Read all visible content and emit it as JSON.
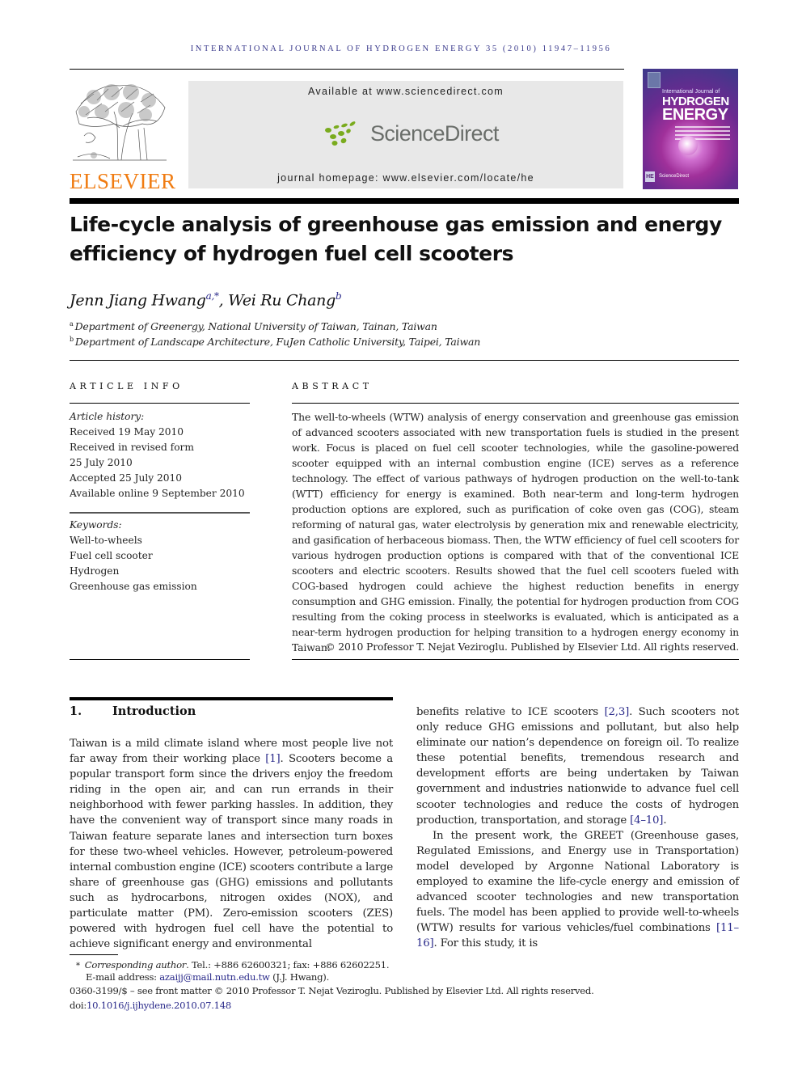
{
  "running_header": "INTERNATIONAL JOURNAL OF HYDROGEN ENERGY 35 (2010) 11947–11956",
  "header": {
    "publisher_name": "ELSEVIER",
    "available_at": "Available at www.sciencedirect.com",
    "sciencedirect_name": "ScienceDirect",
    "homepage": "journal homepage: www.elsevier.com/locate/he",
    "cover": {
      "line1": "International Journal of",
      "line2": "HYDROGEN",
      "line3": "ENERGY",
      "badge": "HE",
      "footer": "ScienceDirect"
    },
    "colors": {
      "elsevier_orange": "#f07c12",
      "sciencedirect_green": "#7aab1e",
      "sciencedirect_gray": "#6a6e6a",
      "banner_gray": "#e8e8e8",
      "link_blue": "#2a2a8a"
    }
  },
  "article": {
    "title": "Life-cycle analysis of greenhouse gas emission and energy efficiency of hydrogen fuel cell scooters",
    "authors": [
      {
        "name": "Jenn Jiang Hwang",
        "marks": "a,*"
      },
      {
        "name": "Wei Ru Chang",
        "marks": "b"
      }
    ],
    "author_separator": ", ",
    "affiliations": [
      {
        "mark": "a",
        "text": "Department of Greenergy, National University of Taiwan, Tainan, Taiwan"
      },
      {
        "mark": "b",
        "text": "Department of Landscape Architecture, FuJen Catholic University, Taipei, Taiwan"
      }
    ]
  },
  "article_info": {
    "label": "ARTICLE INFO",
    "history_label": "Article history:",
    "history": [
      "Received 19 May 2010",
      "Received in revised form",
      "25 July 2010",
      "Accepted 25 July 2010",
      "Available online 9 September 2010"
    ],
    "keywords_label": "Keywords:",
    "keywords": [
      "Well-to-wheels",
      "Fuel cell scooter",
      "Hydrogen",
      "Greenhouse gas emission"
    ]
  },
  "abstract": {
    "label": "ABSTRACT",
    "text": "The well-to-wheels (WTW) analysis of energy conservation and greenhouse gas emission of advanced scooters associated with new transportation fuels is studied in the present work. Focus is placed on fuel cell scooter technologies, while the gasoline-powered scooter equipped with an internal combustion engine (ICE) serves as a reference technology. The effect of various pathways of hydrogen production on the well-to-tank (WTT) efficiency for energy is examined. Both near-term and long-term hydrogen production options are explored, such as purification of coke oven gas (COG), steam reforming of natural gas, water electrolysis by generation mix and renewable electricity, and gasification of herba­ceous biomass. Then, the WTW efficiency of fuel cell scooters for various hydrogen production options is compared with that of the conventional ICE scooters and electric scooters. Results showed that the fuel cell scooters fueled with COG-based hydrogen could achieve the highest reduction benefits in energy consumption and GHG emission. Finally, the potential for hydrogen production from COG resulting from the coking process in steelworks is evaluated, which is anticipated as a near-term hydrogen production for helping transition to a hydrogen energy economy in Taiwan.",
    "copyright": "© 2010 Professor T. Nejat Veziroglu. Published by Elsevier Ltd. All rights reserved."
  },
  "introduction": {
    "number": "1.",
    "heading": "Introduction",
    "left_column": [
      {
        "t": "Taiwan is a mild climate island where most people live not far away from their working place "
      },
      {
        "ref": "[1]"
      },
      {
        "t": ". Scooters become a popular transport form since the drivers enjoy the freedom riding in the open air, and can run errands in their neighborhood with fewer parking hassles. In addition, they have the convenient way of transport since many roads in Taiwan feature separate lanes and intersection turn boxes for these two-wheel vehi­cles. However, petroleum-powered internal combustion engine (ICE) scooters contribute a large share of greenhouse gas (GHG) emissions and pollutants such as hydrocarbons, nitrogen oxides (NOX), and particulate matter (PM). Zero-emission scooters (ZES) powered with hydrogen fuel cell have the potential to achieve significant energy and environmental"
      }
    ],
    "right_column_p1": [
      {
        "t": "benefits relative to ICE scooters "
      },
      {
        "ref": "[2,3]"
      },
      {
        "t": ". Such scooters not only reduce GHG emissions and pollutant, but also help eliminate our nation’s dependence on foreign oil. To realize these potential benefits, tremendous research and development efforts are being undertaken by Taiwan government and industries nationwide to advance fuel cell scooter technolo­gies and reduce the costs of hydrogen production, trans­portation, and storage "
      },
      {
        "ref": "[4–10]"
      },
      {
        "t": "."
      }
    ],
    "right_column_p2": [
      {
        "t": "In the present work, the GREET (Greenhouse gases, Regu­lated Emissions, and Energy use in Transportation) model developed by Argonne National Laboratory is employed to examine the life-cycle energy and emission of advanced scooter technologies and new transportation fuels. The model has been applied to provide well-to-wheels (WTW) results for various vehicles/fuel combinations "
      },
      {
        "ref": "[11–16]"
      },
      {
        "t": ". For this study, it is"
      }
    ]
  },
  "footnotes": {
    "star": "*",
    "corresponding_label": "Corresponding author",
    "contact": ". Tel.: +886 62600321; fax: +886 62602251.",
    "email_label": "E-mail address: ",
    "email": "azaijj@mail.nutn.edu.tw",
    "email_suffix": " (J.J. Hwang).",
    "front_matter": "0360-3199/$ – see front matter © 2010 Professor T. Nejat Veziroglu. Published by Elsevier Ltd. All rights reserved.",
    "doi_label": "doi:",
    "doi": "10.1016/j.ijhydene.2010.07.148"
  }
}
